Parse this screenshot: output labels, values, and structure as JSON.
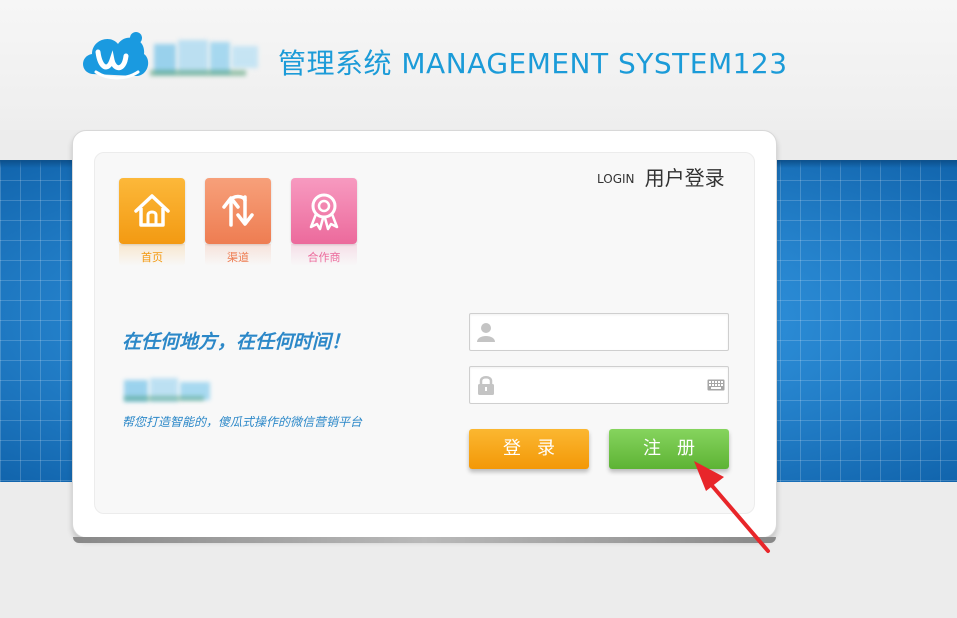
{
  "header": {
    "title": "管理系统 MANAGEMENT SYSTEM123",
    "logo_icon": "cloud-logo-icon"
  },
  "login_panel": {
    "heading_en": "LOGIN",
    "heading_cn": "用户登录"
  },
  "tiles": [
    {
      "label": "首页",
      "icon": "home-icon",
      "color": "#f7a41d"
    },
    {
      "label": "渠道",
      "icon": "swap-arrows-icon",
      "color": "#f28a5e"
    },
    {
      "label": "合作商",
      "icon": "award-ribbon-icon",
      "color": "#f07aa8"
    }
  ],
  "promo": {
    "slogan": "在任何地方，在任何时间！",
    "tagline": "帮您打造智能的，傻瓜式操作的微信营销平台"
  },
  "form": {
    "username_value": "",
    "password_value": "",
    "user_icon": "user-icon",
    "lock_icon": "lock-icon",
    "keyboard_icon": "keyboard-icon",
    "login_label": "登录",
    "register_label": "注册"
  },
  "colors": {
    "brand_blue": "#1b9bd8",
    "login_orange": "#f5a20e",
    "register_green": "#6cc146",
    "annotation_red": "#e8262a"
  }
}
